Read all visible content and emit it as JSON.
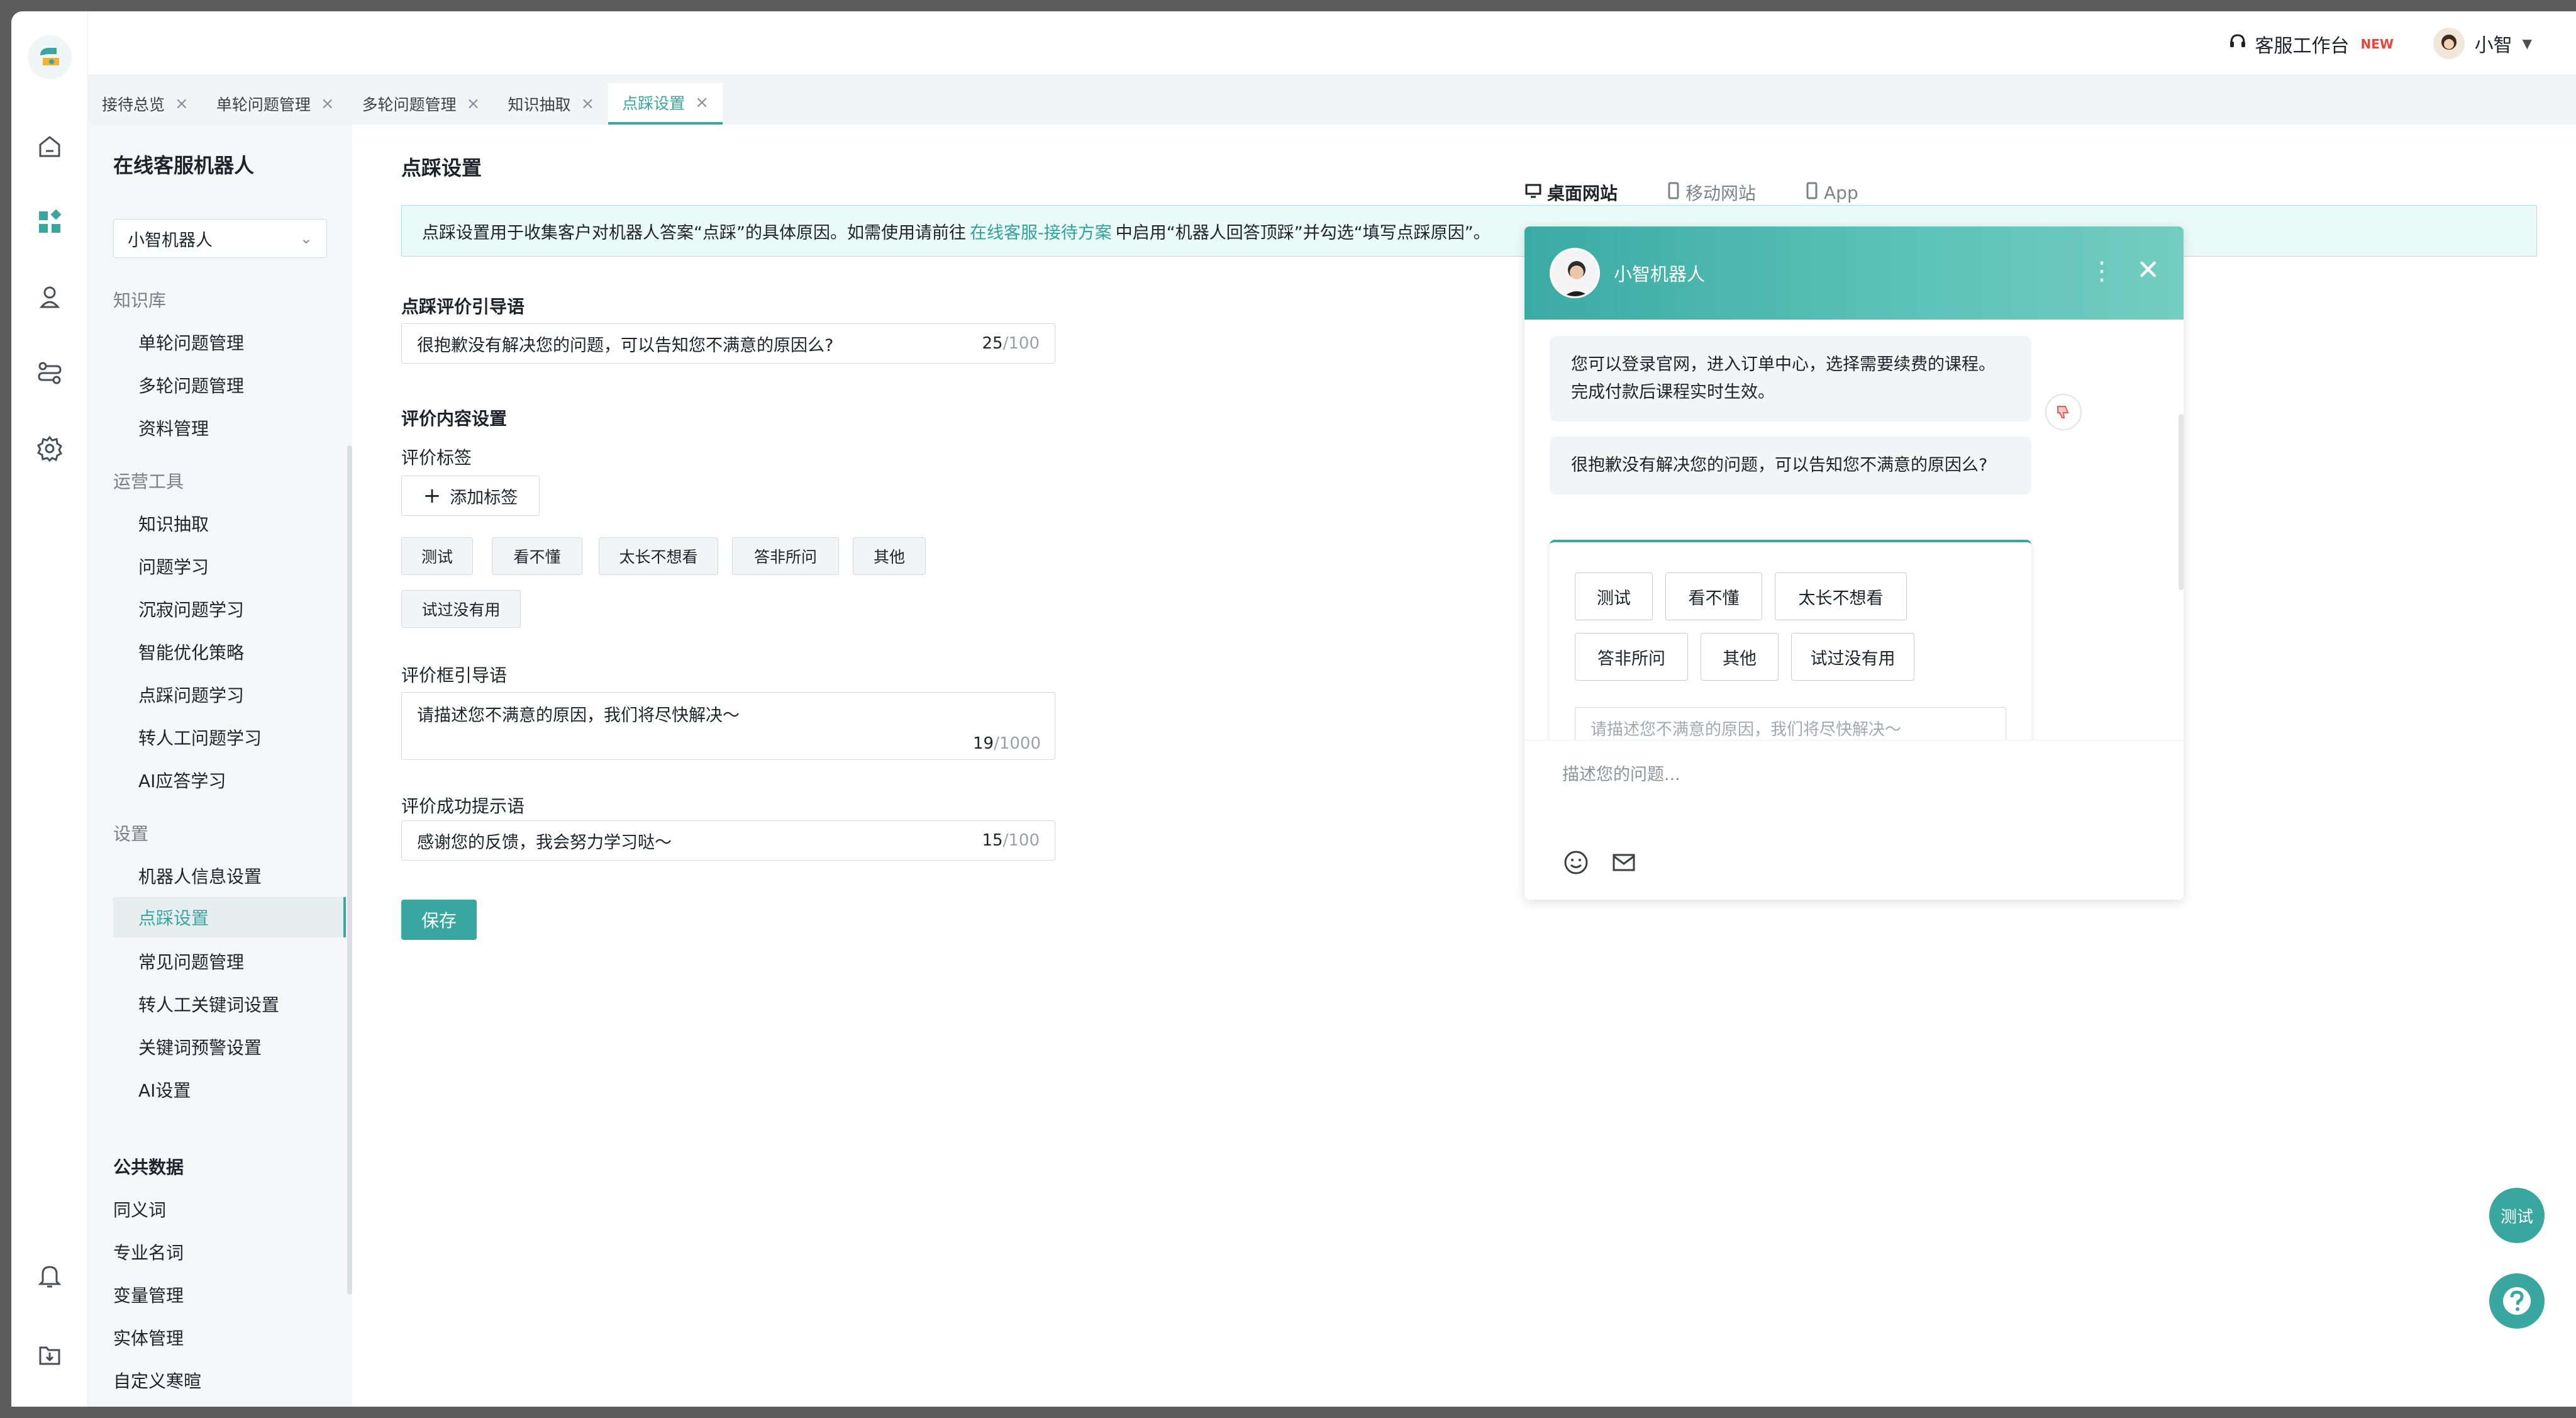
{
  "topbar": {
    "workspace": "客服工作台",
    "new_badge": "NEW",
    "user_name": "小智"
  },
  "tabs": [
    {
      "label": "接待总览"
    },
    {
      "label": "单轮问题管理"
    },
    {
      "label": "多轮问题管理"
    },
    {
      "label": "知识抽取"
    },
    {
      "label": "点踩设置"
    }
  ],
  "sidebar": {
    "title": "在线客服机器人",
    "robot_select": "小智机器人",
    "groups": {
      "knowledge": "知识库",
      "ops": "运营工具",
      "settings": "设置"
    },
    "knowledge_items": [
      "单轮问题管理",
      "多轮问题管理",
      "资料管理"
    ],
    "ops_items": [
      "知识抽取",
      "问题学习",
      "沉寂问题学习",
      "智能优化策略",
      "点踩问题学习",
      "转人工问题学习",
      "AI应答学习"
    ],
    "settings_items": [
      "机器人信息设置",
      "点踩设置",
      "常见问题管理",
      "转人工关键词设置",
      "关键词预警设置",
      "AI设置"
    ],
    "public_title": "公共数据",
    "public_items": [
      "同义词",
      "专业名词",
      "变量管理",
      "实体管理",
      "自定义寒暄"
    ]
  },
  "main": {
    "title": "点踩设置",
    "notice_before": "点踩设置用于收集客户对机器人答案“点踩”的具体原因。如需使用请前往",
    "notice_link": "在线客服-接待方案",
    "notice_after": "中启用“机器人回答顶踩”并勾选“填写点踩原因”。",
    "guide_label": "点踩评价引导语",
    "guide_value": "很抱歉没有解决您的问题，可以告知您不满意的原因么?",
    "guide_count": "25",
    "guide_max": "/100",
    "content_title": "评价内容设置",
    "tags_label": "评价标签",
    "add_tag": "添加标签",
    "tags": [
      "测试",
      "看不懂",
      "太长不想看",
      "答非所问",
      "其他",
      "试过没有用"
    ],
    "box_label": "评价框引导语",
    "box_value": "请描述您不满意的原因，我们将尽快解决～",
    "box_count": "19",
    "box_max": "/1000",
    "success_label": "评价成功提示语",
    "success_value": "感谢您的反馈，我会努力学习哒～",
    "success_count": "15",
    "success_max": "/100",
    "save": "保存"
  },
  "preview": {
    "tabs": [
      "桌面网站",
      "移动网站",
      "App"
    ],
    "bot_name": "小智机器人",
    "msg1": "您可以登录官网，进入订单中心，选择需要续费的课程。完成付款后课程实时生效。",
    "msg2": "很抱歉没有解决您的问题，可以告知您不满意的原因么?",
    "chips": [
      "测试",
      "看不懂",
      "太长不想看",
      "答非所问",
      "其他",
      "试过没有用"
    ],
    "feedback_placeholder": "请描述您不满意的原因，我们将尽快解决～",
    "input_placeholder": "描述您的问题..."
  },
  "floating": {
    "test": "测试"
  },
  "colors": {
    "accent": "#3aa6a0",
    "notice_bg": "#eafaf7",
    "new_badge": "#e8463c"
  }
}
